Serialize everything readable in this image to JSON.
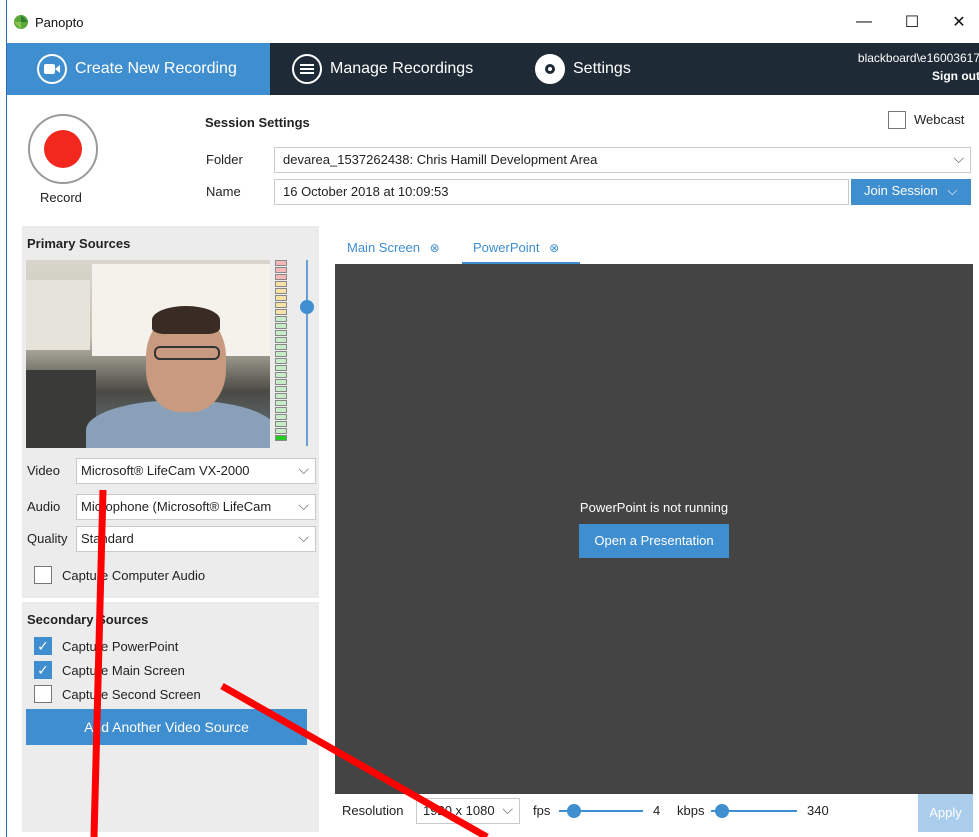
{
  "window": {
    "title": "Panopto",
    "minimize_glyph": "—",
    "maximize_glyph": "☐",
    "close_glyph": "✕"
  },
  "nav": {
    "tabs": [
      {
        "label": "Create New Recording",
        "icon": "camera-icon",
        "active": true
      },
      {
        "label": "Manage Recordings",
        "icon": "list-icon",
        "active": false
      },
      {
        "label": "Settings",
        "icon": "gear-icon",
        "active": false
      }
    ],
    "user": "blackboard\\e16003617",
    "sign_out": "Sign out"
  },
  "record": {
    "label": "Record"
  },
  "session": {
    "title": "Session Settings",
    "webcast_label": "Webcast",
    "webcast_checked": false,
    "folder_label": "Folder",
    "folder_value": "devarea_1537262438: Chris Hamill Development Area",
    "name_label": "Name",
    "name_value": "16 October 2018 at 10:09:53",
    "join_label": "Join Session"
  },
  "primary": {
    "title": "Primary Sources",
    "video_label": "Video",
    "video_value": "Microsoft® LifeCam VX-2000",
    "audio_label": "Audio",
    "audio_value": "Microphone (Microsoft® LifeCam",
    "quality_label": "Quality",
    "quality_value": "Standard",
    "capture_audio_label": "Capture Computer Audio",
    "capture_audio_checked": false
  },
  "secondary": {
    "title": "Secondary Sources",
    "items": [
      {
        "label": "Capture PowerPoint",
        "checked": true
      },
      {
        "label": "Capture Main Screen",
        "checked": true
      },
      {
        "label": "Capture Second Screen",
        "checked": false
      }
    ],
    "add_source_label": "Add Another Video Source"
  },
  "preview": {
    "tabs": [
      {
        "label": "Main Screen",
        "active": false
      },
      {
        "label": "PowerPoint",
        "active": true
      }
    ],
    "close_glyph": "⊗",
    "message": "PowerPoint is not running",
    "open_button": "Open a Presentation"
  },
  "encoding": {
    "resolution_label": "Resolution",
    "resolution_value": "1920 x 1080",
    "fps_label": "fps",
    "fps_value": "4",
    "kbps_label": "kbps",
    "kbps_value": "340",
    "apply_label": "Apply"
  },
  "colors": {
    "accent": "#3e8ed0",
    "navbar": "#1e2a35",
    "record": "#f2271e",
    "preview_bg": "#444444",
    "annotation": "#ff0000"
  }
}
